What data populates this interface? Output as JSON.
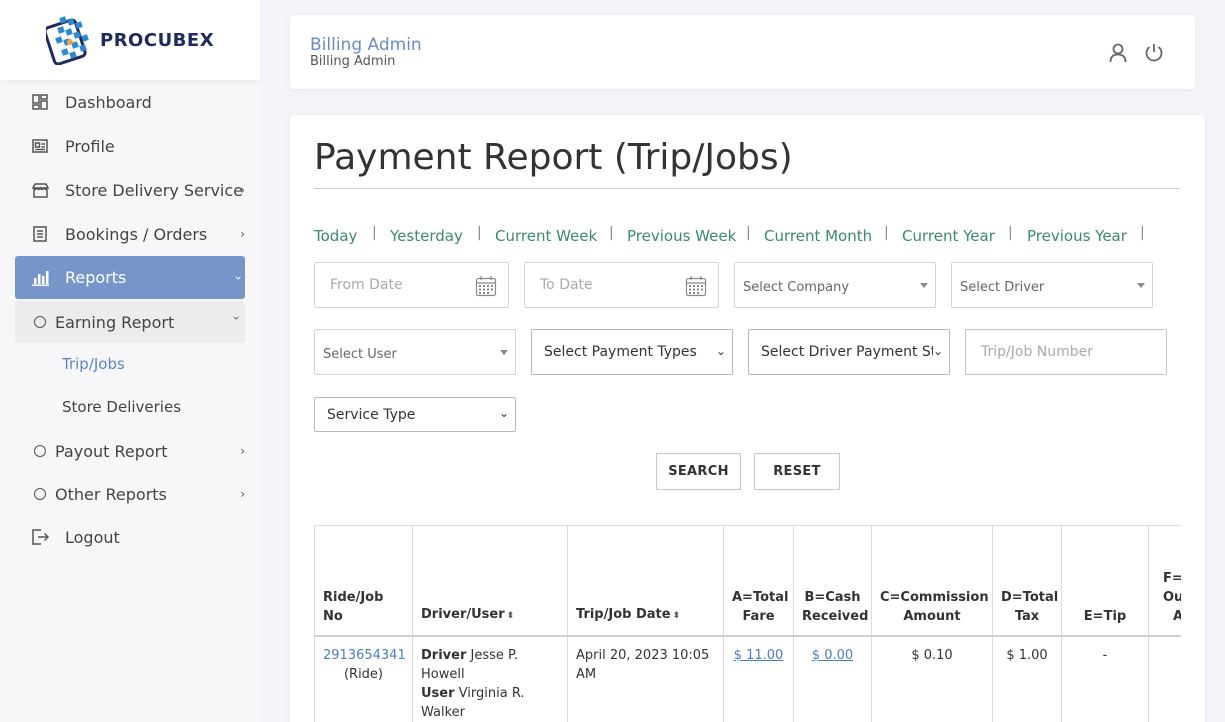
{
  "brand": {
    "name_part1": "PRO",
    "name_part2": "CUBEX"
  },
  "sidebar": {
    "items": [
      {
        "label": "Dashboard",
        "icon": "dashboard-icon"
      },
      {
        "label": "Profile",
        "icon": "profile-icon"
      },
      {
        "label": "Store Delivery Service",
        "icon": "store-icon"
      },
      {
        "label": "Bookings / Orders",
        "icon": "bookings-icon"
      },
      {
        "label": "Reports",
        "icon": "reports-icon"
      },
      {
        "label": "Earning Report",
        "icon": "circle-icon"
      },
      {
        "label": "Payout Report",
        "icon": "circle-icon"
      },
      {
        "label": "Other Reports",
        "icon": "circle-icon"
      },
      {
        "label": "Logout",
        "icon": "logout-icon"
      }
    ],
    "sub_items": [
      {
        "label": "Trip/Jobs"
      },
      {
        "label": "Store Deliveries"
      }
    ]
  },
  "header": {
    "title": "Billing Admin",
    "subtitle": "Billing Admin"
  },
  "main": {
    "title": "Payment Report (Trip/Jobs)",
    "quick_filters": [
      "Today",
      "Yesterday",
      "Current Week",
      "Previous Week",
      "Current Month",
      "Current Year",
      "Previous Year"
    ],
    "separator": "|",
    "filters": {
      "from_date": "From Date",
      "to_date": "To Date",
      "company": "Select Company",
      "driver": "Select Driver",
      "user": "Select User",
      "payment_types": "Select Payment Types",
      "driver_payment_status": "Select Driver Payment St",
      "trip_number": "Trip/Job Number",
      "service_type": "Service Type"
    },
    "buttons": {
      "search": "SEARCH",
      "reset": "RESET"
    },
    "table": {
      "headers": {
        "ride_no": "Ride/Job No",
        "driver_user": "Driver/User",
        "trip_date": "Trip/Job Date",
        "total_fare_1": "A=Total",
        "total_fare_2": "Fare",
        "cash_1": "B=Cash",
        "cash_2": "Received",
        "commission_1": "C=Commission",
        "commission_2": "Amount",
        "tax_1": "D=Total",
        "tax_2": "Tax",
        "tip": "E=Tip",
        "f_1": "F=",
        "f_2": "Out",
        "f_3": "A"
      },
      "rows": [
        {
          "ride_no": "2913654341",
          "ride_type": "(Ride)",
          "driver_label": "Driver",
          "driver_name": "Jesse P. Howell",
          "user_label": "User",
          "user_name": "Virginia R. Walker",
          "date": "April 20, 2023 10:05 AM",
          "total_fare": "$ 11.00",
          "cash": "$ 0.00",
          "commission": "$ 0.10",
          "tax": "$ 1.00",
          "tip": "-"
        }
      ]
    }
  }
}
